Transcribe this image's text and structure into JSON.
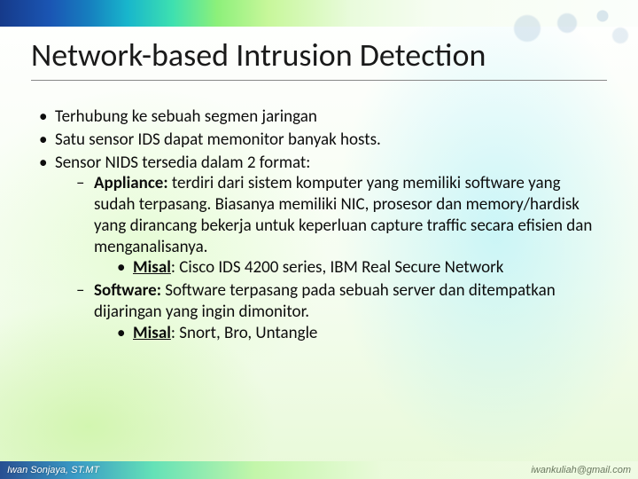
{
  "slide": {
    "title": "Network-based Intrusion Detection",
    "bullets": [
      {
        "text": "Terhubung ke sebuah segmen jaringan"
      },
      {
        "text": "Satu sensor IDS dapat memonitor banyak hosts."
      },
      {
        "text": "Sensor NIDS tersedia dalam 2 format:",
        "sub": [
          {
            "lead": "Appliance:",
            "text": "  terdiri dari sistem komputer yang memiliki software  yang sudah terpasang. Biasanya memiliki NIC, prosesor dan memory/hardisk yang dirancang bekerja untuk keperluan capture traffic secara efisien dan menganalisanya.",
            "sub": [
              {
                "lead": "Misal",
                "text": ": Cisco IDS 4200 series, IBM Real Secure Network"
              }
            ]
          },
          {
            "lead": "Software:",
            "text": " Software terpasang pada sebuah server dan ditempatkan dijaringan yang ingin dimonitor.",
            "sub": [
              {
                "lead": "Misal",
                "text": ": Snort, Bro, Untangle"
              }
            ]
          }
        ]
      }
    ]
  },
  "footer": {
    "author": "Iwan Sonjaya, ST.MT",
    "email": "iwankuliah@gmail.com"
  }
}
